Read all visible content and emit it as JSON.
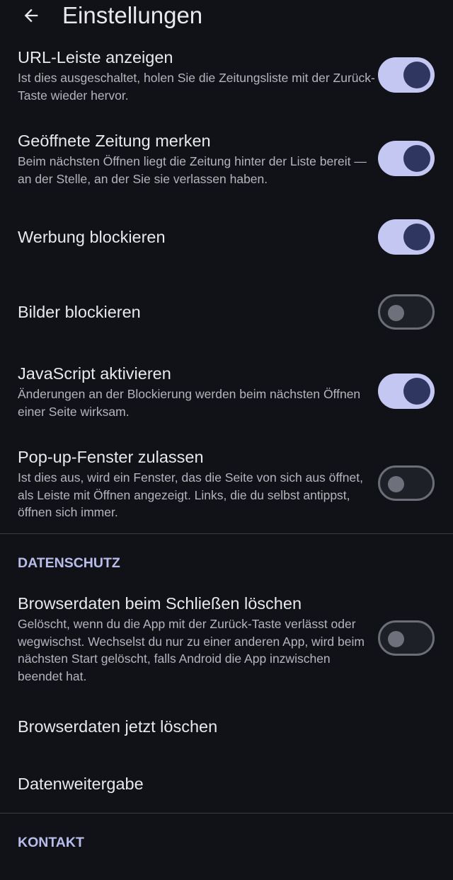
{
  "header": {
    "title": "Einstellungen",
    "back_icon": "arrow-left-icon"
  },
  "settings": [
    {
      "title": "URL-Leiste anzeigen",
      "desc": "Ist dies ausgeschaltet, holen Sie die Zeitungsliste mit der Zurück-Taste wieder hervor.",
      "on": true
    },
    {
      "title": "Geöffnete Zeitung merken",
      "desc": "Beim nächsten Öffnen liegt die Zeitung hinter der Liste bereit — an der Stelle, an der Sie sie verlassen haben.",
      "on": true
    },
    {
      "title": "Werbung blockieren",
      "on": true
    },
    {
      "title": "Bilder blockieren",
      "on": false
    },
    {
      "title": "JavaScript aktivieren",
      "desc": "Änderungen an der Blockierung werden beim nächsten Öffnen einer Seite wirksam.",
      "on": true
    },
    {
      "title": "Pop-up-Fenster zulassen",
      "desc": "Ist dies aus, wird ein Fenster, das die Seite von sich aus öffnet, als Leiste mit Öffnen angezeigt. Links, die du selbst antippst, öffnen sich immer.",
      "on": false
    }
  ],
  "privacy": {
    "header": "DATENSCHUTZ",
    "clear_on_close": {
      "title": "Browserdaten beim Schließen löschen",
      "desc": "Gelöscht, wenn du die App mit der Zurück-Taste verlässt oder wegwischst. Wechselst du nur zu einer anderen App, wird beim nächsten Start gelöscht, falls Android die App inzwischen beendet hat.",
      "on": false
    },
    "clear_now": "Browserdaten jetzt löschen",
    "data_sharing": "Datenweitergabe"
  },
  "contact": {
    "header": "KONTAKT"
  },
  "colors": {
    "background": "#111217",
    "toggle_on_track": "#c3c7f2",
    "toggle_on_knob": "#2f3760",
    "section_header": "#b9bdec"
  }
}
